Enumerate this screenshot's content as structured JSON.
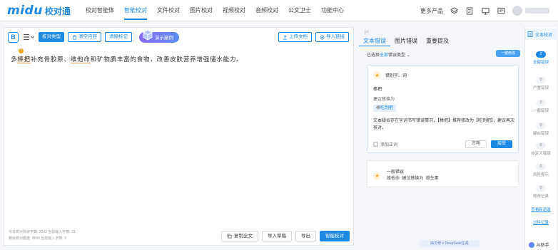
{
  "logo": {
    "word": "midu",
    "cn": "校对通"
  },
  "nav": [
    "校对智能体",
    "智能校对",
    "文件校对",
    "图片校对",
    "视频校对",
    "音频校对",
    "公文卫士",
    "功能中心"
  ],
  "top_right": {
    "more": "更多产品"
  },
  "toolbar": {
    "b_icon": "B",
    "type_btn": "校对类型",
    "clear_btn": "清空内容",
    "clear_mark_btn": "清除标记",
    "demo_btn": "演示案例",
    "upload_btn": "上传文档",
    "import_btn": "导入链接"
  },
  "editor": {
    "t1": "多",
    "err1": "棒把",
    "t2": "补充骨胶原、",
    "err2": "维他命",
    "t3": "和矿物质丰富的食物，改善皮肤营养增强储水能力。",
    "warn": "!"
  },
  "stats": {
    "line1": "今日校对剩余字数: 3942    当前输入字数: 31",
    "line2": "剩余校对额度: 9999    当前输入字数: 3"
  },
  "bottom": {
    "copy": "复制全文",
    "import": "导入草稿",
    "export": "导出",
    "check": "智能校对"
  },
  "panel": {
    "collapse": "|<",
    "tabs": [
      "文本错误",
      "图片错误",
      "重要提及"
    ],
    "filter_prefix": "已选择",
    "filter_value": "全部",
    "filter_suffix": "错误类型",
    "fix_all": "一键修改",
    "card1": {
      "label": "错别字、词",
      "word": "棒把",
      "suggest": "建议替换为",
      "old": "棒",
      "new": "吃到把",
      "desc": "文本疑似存在字词书写错误情况，【棒把】推荐修改为【吃到把】，建议再次核对。",
      "add": "添加正词",
      "ignore": "忽略",
      "accept": "接受"
    },
    "card2": {
      "label": "一般错误",
      "word": "维他命",
      "suggest": "建议替换为",
      "new": "维生素"
    }
  },
  "deepseek": "由文修 x DeepSeek生成",
  "sidebar": {
    "title": "文本校对",
    "items": [
      {
        "num": "2",
        "label": "全部错误"
      },
      {
        "num": "0",
        "label": "严重错误"
      },
      {
        "num": "2",
        "label": "一般错误"
      },
      {
        "num": "0",
        "label": "疑似错误"
      },
      {
        "num": "0",
        "label": "自定义错误"
      },
      {
        "num": "0",
        "label": "风险提示"
      },
      {
        "num": "0",
        "label": "修改记录"
      }
    ],
    "link1": "查看新语录",
    "link2": "过往记录"
  },
  "ai": "AI助手",
  "colors": {
    "brand": "#1e88e5",
    "warning": "#f5a623"
  }
}
